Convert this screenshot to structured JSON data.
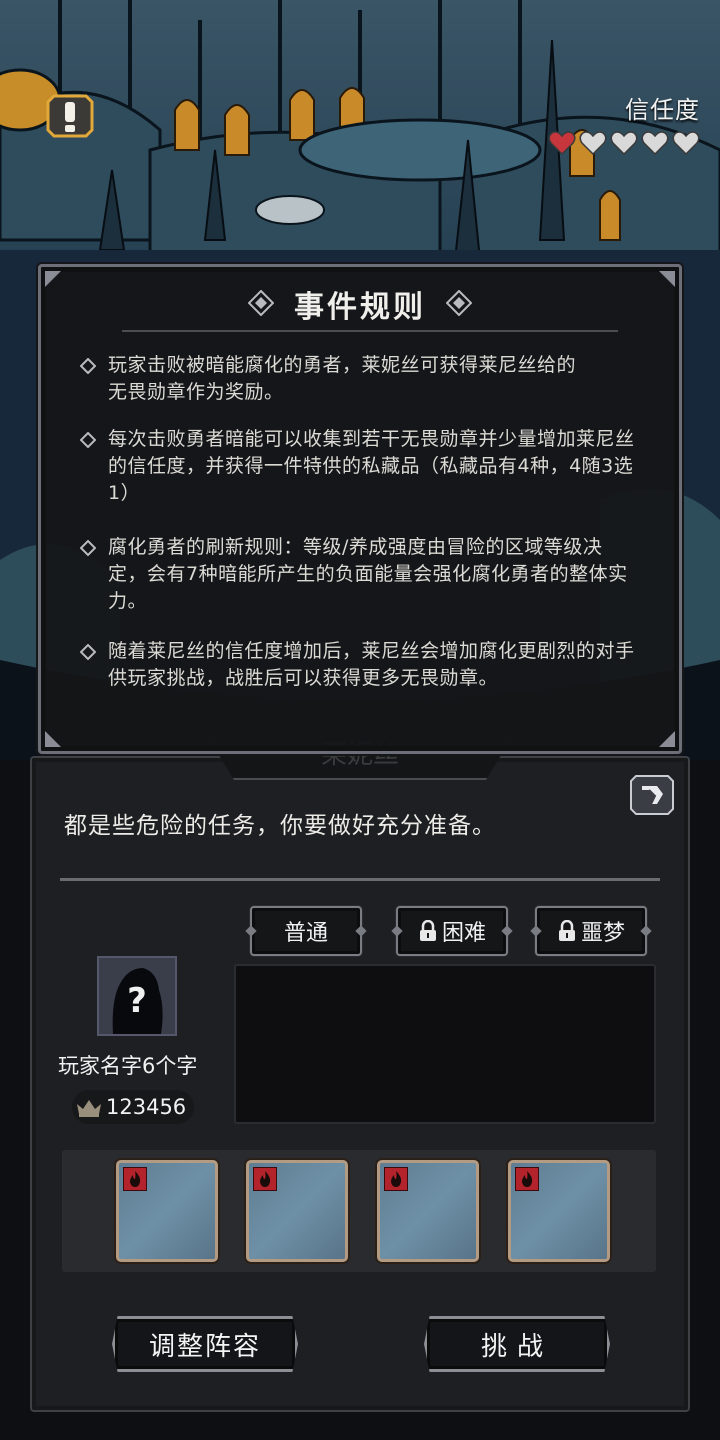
{
  "trust": {
    "label": "信任度",
    "filled_hearts": 1,
    "total_hearts": 5,
    "filled_color": "#c8363d",
    "empty_color": "#d9d9d9"
  },
  "alert": {
    "icon": "exclamation-icon"
  },
  "rules_popup": {
    "title": "事件规则",
    "rules": [
      "玩家击败被暗能腐化的勇者，莱妮丝可获得莱尼丝给的无畏勋章作为奖励。",
      "每次击败勇者暗能可以收集到若干无畏勋章并少量增加莱尼丝的信任度，并获得一件特供的私藏品（私藏品有4种，4随3选1）",
      "腐化勇者的刷新规则：等级/养成强度由冒险的区域等级决定，会有7种暗能所产生的负面能量会强化腐化勇者的整体实力。",
      "随着莱尼丝的信任度增加后，莱尼丝会增加腐化更剧烈的对手供玩家挑战，战胜后可以获得更多无畏勋章。"
    ]
  },
  "panel": {
    "npc_name": "莱妮丝",
    "dialog": "都是些危险的任务，你要做好充分准备。",
    "difficulty": {
      "normal": "普通",
      "hard": "困难",
      "nightmare": "噩梦"
    },
    "player": {
      "name": "玩家名字6个字",
      "score": "123456",
      "avatar_icon": "question-mark-icon"
    },
    "slots": [
      {
        "badge_icon": "flame-icon"
      },
      {
        "badge_icon": "flame-icon"
      },
      {
        "badge_icon": "flame-icon"
      },
      {
        "badge_icon": "flame-icon"
      }
    ],
    "buttons": {
      "adjust": "调整阵容",
      "challenge": "挑战"
    }
  },
  "colors": {
    "panel_bg": "#1e1f22",
    "popup_bg": "#141518",
    "accent_border": "#8c8e96",
    "slot_border": "#b39a82",
    "badge_red": "#b3232b"
  }
}
